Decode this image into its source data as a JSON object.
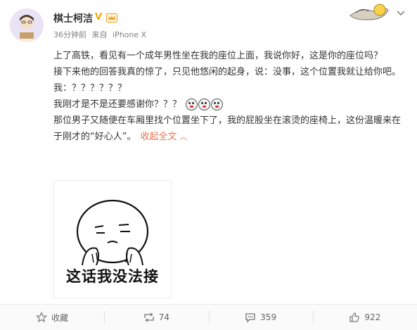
{
  "post": {
    "username": "棋士柯洁",
    "verified_mark": "V",
    "time": "36分钟前",
    "source_prefix": "来自",
    "source_device": "iPhone X",
    "paragraphs": [
      "上了高铁，看见有一个成年男性坐在我的座位上面，我说你好，这是你的座位吗？",
      "接下来他的回答我真的惊了，只见他悠闲的起身，说：没事，这个位置我就让给你吧。",
      "我：？？？？？？",
      "我刚才是不是还要感谢你？？？",
      "那位男子又随便在车厢里找个位置坐下了，我的屁股坐在滚烫的座椅上，这份温暖来在于刚才的“好心人”。"
    ],
    "collapse_label": "收起全文",
    "image_caption": "这话我没法接"
  },
  "footer": {
    "favorite_label": "收藏",
    "repost_count": "74",
    "comment_count": "359",
    "like_count": "922"
  },
  "icons": {
    "verified": "verified-v-icon",
    "vip": "vip-crown-icon",
    "dropdown": "chevron-down-icon",
    "favorite": "star-icon",
    "repost": "repost-icon",
    "comment": "comment-icon",
    "like": "thumbs-up-icon"
  },
  "colors": {
    "link": "#eb7350",
    "verified": "#f7a500",
    "meta_text": "#808080"
  }
}
